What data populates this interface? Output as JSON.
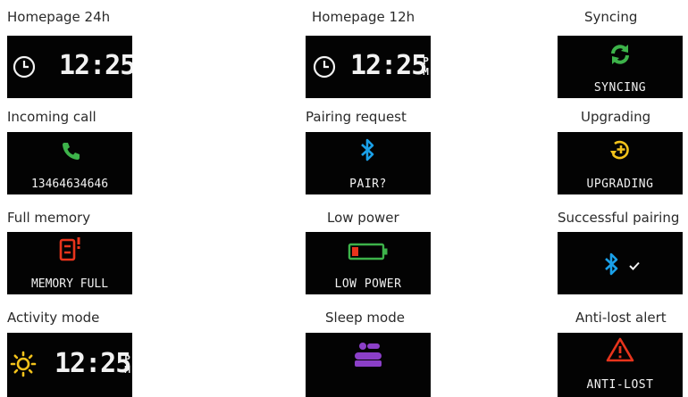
{
  "panels": {
    "home24": {
      "caption": "Homepage 24h",
      "time": "12:25"
    },
    "home12": {
      "caption": "Homepage 12h",
      "time": "12:25",
      "am_pm": [
        "P",
        "M"
      ]
    },
    "syncing": {
      "caption": "Syncing",
      "status": "SYNCING",
      "icon": "sync-icon",
      "color": "#3db34a"
    },
    "call": {
      "caption": "Incoming call",
      "number": "13464634646",
      "icon": "phone-icon",
      "color": "#3db34a"
    },
    "pairing": {
      "caption": "Pairing request",
      "status": "PAIR?",
      "icon": "bluetooth-icon",
      "color": "#1aa0e8"
    },
    "upgrading": {
      "caption": "Upgrading",
      "status": "UPGRADING",
      "icon": "upgrade-icon",
      "color": "#f2c21b"
    },
    "memory": {
      "caption": "Full memory",
      "status": "MEMORY FULL",
      "icon": "memory-full-icon",
      "color": "#e8341c"
    },
    "power": {
      "caption": "Low power",
      "status": "LOW POWER",
      "icon": "battery-low-icon",
      "color": "#3db34a"
    },
    "paired": {
      "caption": "Successful pairing",
      "icon": "bluetooth-check-icon",
      "color": "#1aa0e8"
    },
    "activity": {
      "caption": "Activity mode",
      "time": "12:25",
      "am_pm": [
        "P",
        "M"
      ],
      "icon": "sun-icon",
      "color": "#f2c21b"
    },
    "sleep": {
      "caption": "Sleep mode",
      "icon": "bed-icon",
      "color": "#8b3fc8"
    },
    "antilost": {
      "caption": "Anti-lost alert",
      "status": "ANTI-LOST",
      "icon": "warning-icon",
      "color": "#e8341c"
    }
  }
}
